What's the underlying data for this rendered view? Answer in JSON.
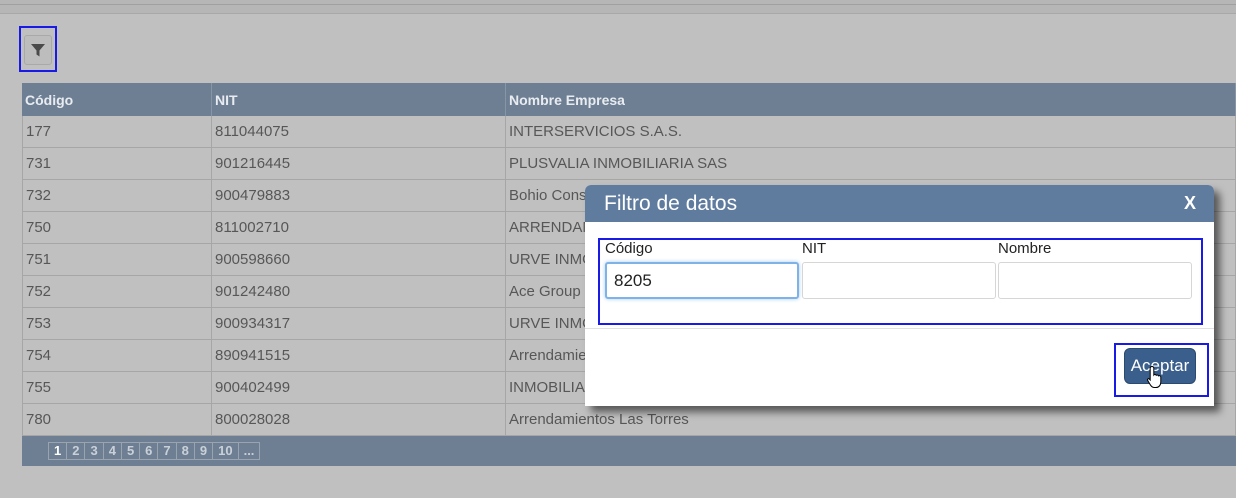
{
  "toolbar": {
    "filter_icon": "funnel-icon"
  },
  "table": {
    "columns": [
      "Código",
      "NIT",
      "Nombre Empresa"
    ],
    "rows": [
      [
        "177",
        "811044075",
        "INTERSERVICIOS S.A.S."
      ],
      [
        "731",
        "901216445",
        "PLUSVALIA INMOBILIARIA SAS"
      ],
      [
        "732",
        "900479883",
        "Bohio Cons"
      ],
      [
        "750",
        "811002710",
        "ARRENDAM"
      ],
      [
        "751",
        "900598660",
        "URVE INMO"
      ],
      [
        "752",
        "901242480",
        "Ace Group s"
      ],
      [
        "753",
        "900934317",
        "URVE INMO"
      ],
      [
        "754",
        "890941515",
        "Arrendamien"
      ],
      [
        "755",
        "900402499",
        "INMOBILIAR"
      ],
      [
        "780",
        "800028028",
        "Arrendamientos Las Torres"
      ]
    ]
  },
  "pager": {
    "pages": [
      "1",
      "2",
      "3",
      "4",
      "5",
      "6",
      "7",
      "8",
      "9",
      "10",
      "..."
    ],
    "current": "1"
  },
  "modal": {
    "title": "Filtro de datos",
    "close_label": "X",
    "fields": {
      "codigo": {
        "label": "Código",
        "value": "8205"
      },
      "nit": {
        "label": "NIT",
        "value": ""
      },
      "nombre": {
        "label": "Nombre",
        "value": ""
      }
    },
    "accept_label": "Aceptar"
  },
  "colors": {
    "header": "#6e7f94",
    "modal_title": "#5f7c9f",
    "accept_button": "#3a5f8c",
    "highlight": "#1a1ae6"
  }
}
